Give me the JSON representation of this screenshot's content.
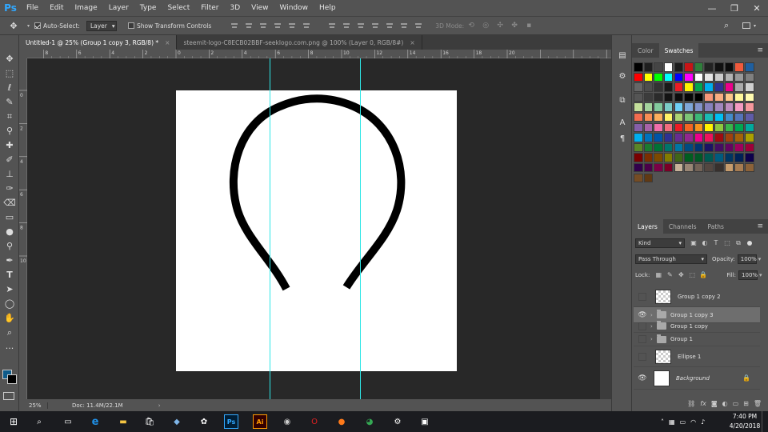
{
  "app": {
    "logo": "Ps"
  },
  "menu": [
    "File",
    "Edit",
    "Image",
    "Layer",
    "Type",
    "Select",
    "Filter",
    "3D",
    "View",
    "Window",
    "Help"
  ],
  "window_controls": [
    "—",
    "❐",
    "✕"
  ],
  "options": {
    "auto_select_label": "Auto-Select:",
    "auto_select_checked": true,
    "auto_select_value": "Layer",
    "transform_label": "Show Transform Controls",
    "mode_3d_label": "3D Mode:"
  },
  "tabs": [
    {
      "label": "Untitled-1 @ 25% (Group 1 copy 3, RGB/8) *",
      "active": true
    },
    {
      "label": "steemit-logo-C8ECB02BBF-seeklogo.com.png @ 100% (Layer 0, RGB/8#)",
      "active": false
    }
  ],
  "ruler": {
    "top_labels": [
      "8",
      "6",
      "4",
      "2",
      "0",
      "2",
      "4",
      "6",
      "8",
      "10",
      "12",
      "14",
      "16",
      "18",
      "20"
    ],
    "left_labels": [
      "0",
      "2",
      "4",
      "6",
      "8",
      "10"
    ]
  },
  "status": {
    "zoom": "25%",
    "doc": "Doc: 11.4M/22.1M"
  },
  "color_panel": {
    "tabs": [
      "Color",
      "Swatches"
    ],
    "active": "Swatches"
  },
  "swatches": [
    [
      "#000000",
      "#1f1f1f",
      "#454545",
      "#ffffff",
      "#1c1c1c",
      "#c81416",
      "#2f7f3b",
      "#232323",
      "#111111",
      "#0c0c0c",
      "#f05a3c",
      "#1f5f9f"
    ],
    [
      "#ff0000",
      "#ffff00",
      "#00ff00",
      "#00ffff",
      "#0000ff",
      "#ff00ff",
      "#ffffff",
      "#e6e6e6",
      "#cccccc",
      "#b3b3b3",
      "#999999",
      "#808080"
    ],
    [
      "#666666",
      "#4d4d4d",
      "#333333",
      "#1a1a1a",
      "#ed1c24",
      "#fff200",
      "#00a651",
      "#00aeef",
      "#2e3192",
      "#ec008c",
      "#aaaaaa",
      "#cfcfcf"
    ],
    [
      "#555555",
      "#3c3c3c",
      "#2b2b2b",
      "#131313",
      "#0d0d0d",
      "#070707",
      "#000000",
      "#f7977a",
      "#f9ad81",
      "#fdc68a",
      "#fff79a",
      "#fffbb0"
    ],
    [
      "#c4df9b",
      "#a3d39c",
      "#82ca9d",
      "#7bcdc8",
      "#6ecff6",
      "#7ea7d8",
      "#8393ca",
      "#8781bd",
      "#a187be",
      "#bd8cbf",
      "#f49ac1",
      "#f6989d"
    ],
    [
      "#f26c4f",
      "#f68e55",
      "#fbaf5d",
      "#fff467",
      "#acd372",
      "#7cc576",
      "#3bb878",
      "#1abbb4",
      "#00bff3",
      "#438ccb",
      "#5574b9",
      "#605ca8"
    ],
    [
      "#855fa8",
      "#a763a8",
      "#f06eaa",
      "#f26d7d",
      "#ed1c24",
      "#f26522",
      "#f7941d",
      "#fff200",
      "#8dc73f",
      "#39b54a",
      "#00a651",
      "#00a99d"
    ],
    [
      "#00aeef",
      "#0072bc",
      "#0054a6",
      "#2e3192",
      "#662d91",
      "#92278f",
      "#ec008c",
      "#ed145b",
      "#9e0b0f",
      "#a0410d",
      "#a36209",
      "#aba000"
    ],
    [
      "#598527",
      "#1a7b30",
      "#007236",
      "#00746b",
      "#0076a3",
      "#004b80",
      "#003471",
      "#1b1464",
      "#440e62",
      "#630460",
      "#9e005d",
      "#9e0039"
    ],
    [
      "#790000",
      "#7b2e00",
      "#7d4900",
      "#827b00",
      "#406618",
      "#005e20",
      "#005826",
      "#005952",
      "#005b7f",
      "#003663",
      "#002157",
      "#0d004c"
    ],
    [
      "#32004b",
      "#4b0049",
      "#7b0046",
      "#7a0026",
      "#c7b299",
      "#998675",
      "#736357",
      "#534741",
      "#37302d",
      "#c69c6d",
      "#a67c52",
      "#8c6239"
    ],
    [
      "#754c24",
      "#603913"
    ]
  ],
  "layers_panel": {
    "tabs": [
      "Layers",
      "Channels",
      "Paths"
    ],
    "active": "Layers",
    "kind": "Kind",
    "blend_mode": "Pass Through",
    "opacity_label": "Opacity:",
    "opacity": "100%",
    "lock_label": "Lock:",
    "fill_label": "Fill:",
    "fill": "100%",
    "layers": [
      {
        "name": "Group 1 copy 2",
        "type": "smart",
        "visible": false,
        "selected": false
      },
      {
        "name": "Group 1 copy 3",
        "type": "group",
        "visible": true,
        "selected": true
      },
      {
        "name": "Group 1 copy",
        "type": "group",
        "visible": false,
        "selected": false
      },
      {
        "name": "Group 1",
        "type": "group",
        "visible": false,
        "selected": false
      },
      {
        "name": "Ellipse 1",
        "type": "smart",
        "visible": false,
        "selected": false
      },
      {
        "name": "Background",
        "type": "background",
        "visible": true,
        "selected": false,
        "locked": true
      }
    ],
    "footer_icons": [
      "link-icon",
      "fx-icon",
      "mask-icon",
      "adjustment-icon",
      "folder-icon",
      "new-layer-icon",
      "trash-icon"
    ]
  },
  "taskbar": {
    "time": "7:40 PM",
    "date": "4/20/2018"
  }
}
